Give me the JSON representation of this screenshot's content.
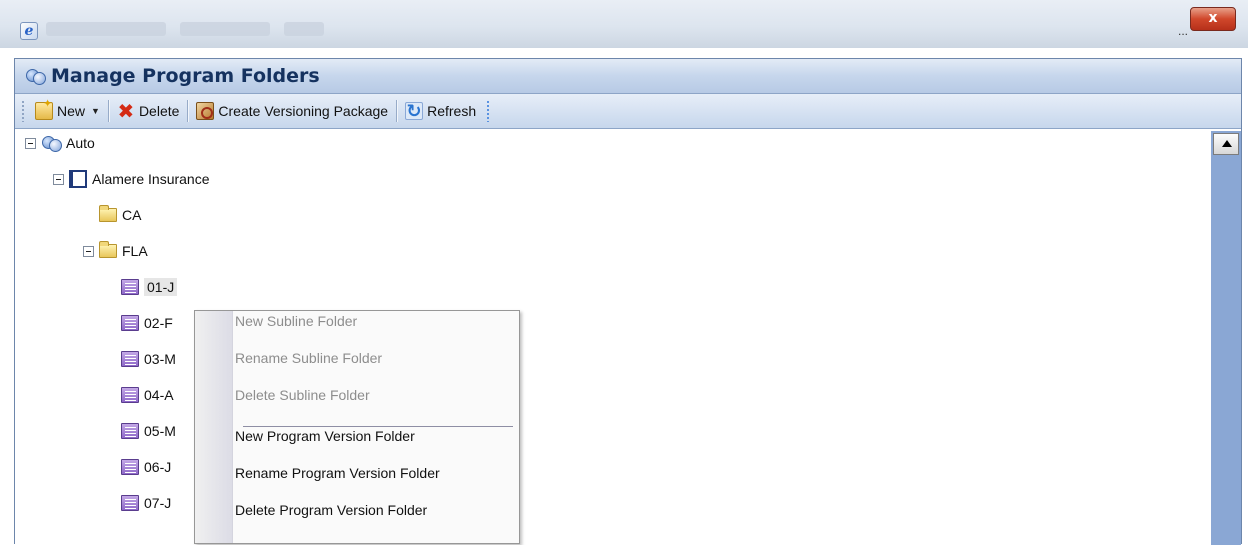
{
  "browser": {
    "icon": "ie-icon",
    "ellipsis": "...",
    "close_label": "x"
  },
  "panel": {
    "title": "Manage Program Folders",
    "title_icon": "people-icon"
  },
  "toolbar": {
    "new_label": "New",
    "delete_label": "Delete",
    "create_package_label": "Create Versioning Package",
    "refresh_label": "Refresh"
  },
  "tree": {
    "root": "Auto",
    "company": "Alamere Insurance",
    "states": [
      "CA",
      "FLA"
    ],
    "program_folders": [
      "01-J",
      "02-F",
      "03-M",
      "04-A",
      "05-M",
      "06-J",
      "07-J"
    ]
  },
  "context_menu": {
    "items": [
      {
        "label": "New Subline Folder",
        "enabled": false
      },
      {
        "label": "Rename Subline Folder",
        "enabled": false
      },
      {
        "label": "Delete Subline Folder",
        "enabled": false
      },
      {
        "label": "New Program Version Folder",
        "enabled": true
      },
      {
        "label": "Rename Program Version Folder",
        "enabled": true
      },
      {
        "label": "Delete Program Version Folder",
        "enabled": true
      }
    ]
  }
}
